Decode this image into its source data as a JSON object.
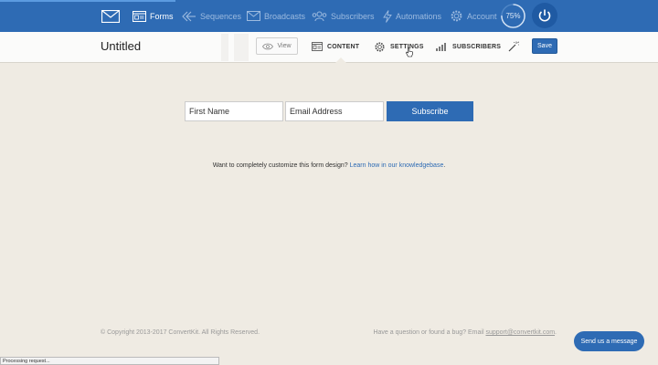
{
  "nav": {
    "items": [
      {
        "label": "Forms",
        "icon": "forms-icon",
        "active": true
      },
      {
        "label": "Sequences",
        "icon": "sequences-icon"
      },
      {
        "label": "Broadcasts",
        "icon": "broadcasts-icon"
      },
      {
        "label": "Subscribers",
        "icon": "subscribers-icon"
      },
      {
        "label": "Automations",
        "icon": "automations-icon"
      },
      {
        "label": "Account",
        "icon": "gear-icon"
      }
    ],
    "progress": "75%",
    "progress_value": 0.75,
    "colors": {
      "bar": "#2e6bb4",
      "inactive": "#9dbbe0",
      "active": "#ffffff"
    }
  },
  "subbar": {
    "title": "Untitled",
    "view_label": "View",
    "tabs": [
      {
        "label": "CONTENT",
        "icon": "content-icon"
      },
      {
        "label": "SETTINGS",
        "icon": "gear-icon"
      },
      {
        "label": "SUBSCRIBERS",
        "icon": "bar-chart-icon"
      }
    ],
    "save_label": "Save"
  },
  "form": {
    "first_name_placeholder": "First Name",
    "email_placeholder": "Email Address",
    "subscribe_label": "Subscribe",
    "customize_text": "Want to completely customize this form design?",
    "customize_link": "Learn how in our knowledgebase",
    "customize_period": "."
  },
  "footer": {
    "copyright": "© Copyright 2013-2017 ConvertKit. All Rights Reserved.",
    "question_text": "Have a question or found a bug? Email",
    "email_link": "support@convertkit.com",
    "period": ".",
    "chat_label": "Send us a message"
  },
  "status": {
    "text": "Processing request..."
  }
}
